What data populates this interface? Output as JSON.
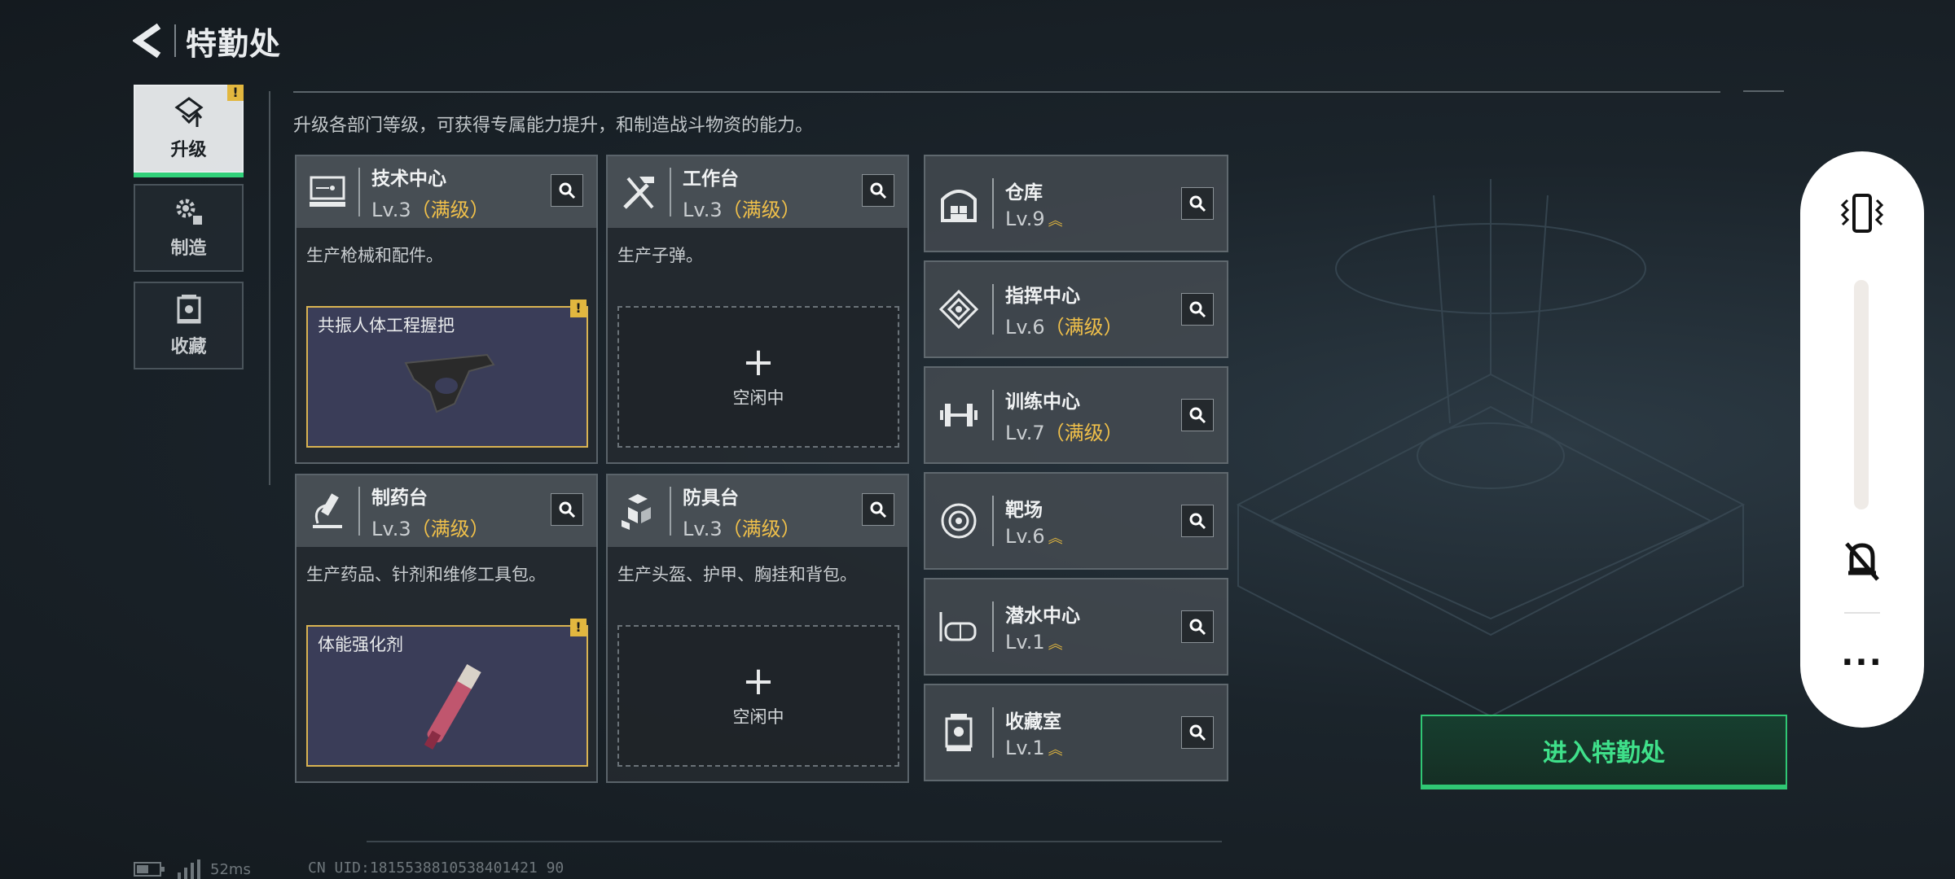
{
  "header": {
    "title": "特勤处"
  },
  "nav": [
    {
      "label": "升级",
      "icon": "upgrade-icon",
      "active": true,
      "badge": "!"
    },
    {
      "label": "制造",
      "icon": "gear-icon",
      "active": false
    },
    {
      "label": "收藏",
      "icon": "collection-icon",
      "active": false
    }
  ],
  "description": "升级各部门等级，可获得专属能力提升，和制造战斗物资的能力。",
  "workshops": [
    {
      "name": "技术中心",
      "level": "Lv.3",
      "max": "（满级）",
      "desc": "生产枪械和配件。",
      "slot": {
        "type": "item",
        "name": "共振人体工程握把",
        "badge": "!"
      }
    },
    {
      "name": "工作台",
      "level": "Lv.3",
      "max": "（满级）",
      "desc": "生产子弹。",
      "slot": {
        "type": "empty",
        "plus": "+",
        "label": "空闲中"
      }
    },
    {
      "name": "制药台",
      "level": "Lv.3",
      "max": "（满级）",
      "desc": "生产药品、针剂和维修工具包。",
      "slot": {
        "type": "item",
        "name": "体能强化剂",
        "badge": "!"
      }
    },
    {
      "name": "防具台",
      "level": "Lv.3",
      "max": "（满级）",
      "desc": "生产头盔、护甲、胸挂和背包。",
      "slot": {
        "type": "empty",
        "plus": "+",
        "label": "空闲中"
      }
    }
  ],
  "facilities": [
    {
      "name": "仓库",
      "level": "Lv.9",
      "max": "",
      "upgrade": "︽"
    },
    {
      "name": "指挥中心",
      "level": "Lv.6",
      "max": "（满级）",
      "upgrade": ""
    },
    {
      "name": "训练中心",
      "level": "Lv.7",
      "max": "（满级）",
      "upgrade": ""
    },
    {
      "name": "靶场",
      "level": "Lv.6",
      "max": "",
      "upgrade": "︽"
    },
    {
      "name": "潜水中心",
      "level": "Lv.1",
      "max": "",
      "upgrade": "︽"
    },
    {
      "name": "收藏室",
      "level": "Lv.1",
      "max": "",
      "upgrade": "︽"
    }
  ],
  "enter_button": "进入特勤处",
  "status": {
    "ping": "52ms",
    "uid": "CN UID:1815538810538401421 90"
  },
  "colors": {
    "accent_green": "#30c774",
    "max_gold": "#f0c04a",
    "badge_yellow": "#e2b73f"
  }
}
